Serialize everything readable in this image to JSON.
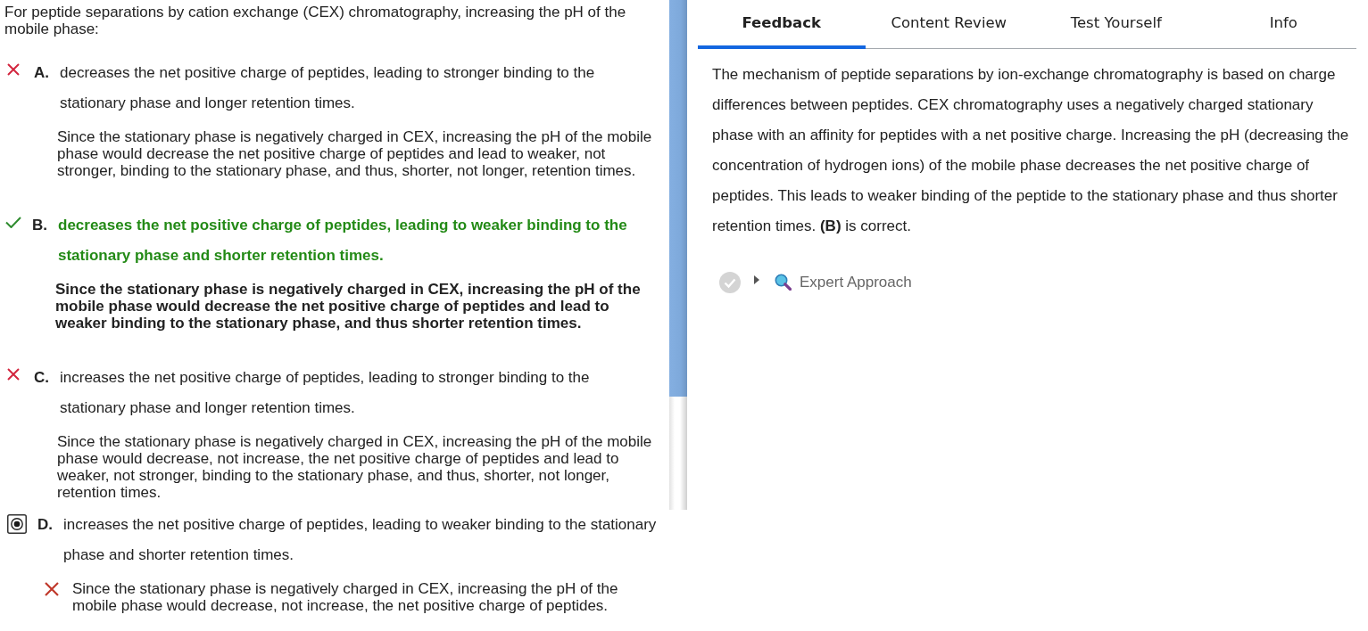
{
  "question": {
    "text": "For peptide separations by cation exchange (CEX) chromatography, increasing the pH of the mobile phase:"
  },
  "options": [
    {
      "letter": "A.",
      "text": "decreases the net positive charge of peptides, leading to stronger binding to the stationary phase and longer retention times.",
      "explanation": "Since the stationary phase is negatively charged in CEX, increasing the pH of the mobile phase would decrease the net positive charge of peptides and lead to weaker, not stronger, binding to the stationary phase, and thus, shorter, not longer, retention times.",
      "selected": false,
      "correct": false
    },
    {
      "letter": "B.",
      "text": "decreases the net positive charge of peptides, leading to weaker binding to the stationary phase and shorter retention times.",
      "explanation": "Since the stationary phase is negatively charged in CEX, increasing the pH of the mobile phase would decrease the net positive charge of peptides and lead to weaker binding to the stationary phase, and thus shorter retention times.",
      "selected": false,
      "correct": true
    },
    {
      "letter": "C.",
      "text": "increases the net positive charge of peptides, leading to stronger binding to the stationary phase and longer retention times.",
      "explanation": "Since the stationary phase is negatively charged in CEX, increasing the pH of the mobile phase would decrease, not increase, the net positive charge of peptides and lead to weaker, not stronger, binding to the stationary phase, and thus, shorter, not longer, retention times.",
      "selected": false,
      "correct": false
    },
    {
      "letter": "D.",
      "text": "increases the net positive charge of peptides, leading to weaker binding to the stationary phase and shorter retention times.",
      "explanation": "Since the stationary phase is negatively charged in CEX, increasing the pH of the mobile phase would decrease, not increase, the net positive charge of peptides.",
      "selected": true,
      "correct": false
    }
  ],
  "tabs": [
    {
      "label": "Feedback",
      "selected": true
    },
    {
      "label": "Content Review",
      "selected": false
    },
    {
      "label": "Test Yourself",
      "selected": false
    },
    {
      "label": "Info",
      "selected": false
    }
  ],
  "feedback": {
    "text": "The mechanism of peptide separations by ion-exchange chromatography is based on charge differences between peptides. CEX chromatography uses a negatively charged stationary phase with an affinity for peptides with a net positive charge. Increasing the pH (decreasing the concentration of hydrogen ions) of the mobile phase decreases the net positive charge of peptides. This leads to weaker binding of the peptide to the stationary phase and thus shorter retention times. **(B)** is correct.",
    "expert_approach": {
      "label": "Expert Approach",
      "expanded": false
    }
  }
}
